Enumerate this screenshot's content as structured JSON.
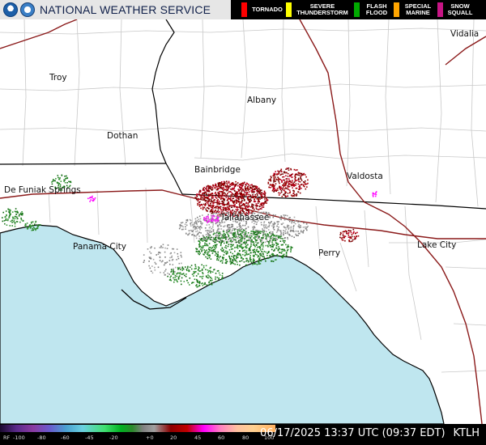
{
  "header": {
    "title": "NATIONAL WEATHER SERVICE",
    "legend": [
      {
        "label": "TORNADO",
        "color": "#ff0000"
      },
      {
        "label": "SEVERE THUNDERSTORM",
        "color": "#ffff00"
      },
      {
        "label": "FLASH FLOOD",
        "color": "#00aa00"
      },
      {
        "label": "SPECIAL MARINE",
        "color": "#ffa500"
      },
      {
        "label": "SNOW SQUALL",
        "color": "#c71585"
      }
    ]
  },
  "places": {
    "vidalia": "Vidalia",
    "troy": "Troy",
    "albany": "Albany",
    "dothan": "Dothan",
    "bainbridge": "Bainbridge",
    "valdosta": "Valdosta",
    "defuniak": "De Funiak Springs",
    "tallahassee": "Tallahassee",
    "panama_city": "Panama City",
    "perry": "Perry",
    "lake_city": "Lake City"
  },
  "colors": {
    "water": "#bfe6ef",
    "land": "#ffffff",
    "county_line": "#c8c8c8",
    "state_line": "#000000",
    "highway": "#8b0000"
  },
  "footer": {
    "scale_labels": [
      "RF",
      "-100",
      "-80",
      "-60",
      "-45",
      "-20",
      "+0",
      "20",
      "45",
      "60",
      "80",
      "100"
    ],
    "datetime": "06/17/2025 13:37 UTC (09:37 EDT)",
    "station": "KTLH"
  }
}
